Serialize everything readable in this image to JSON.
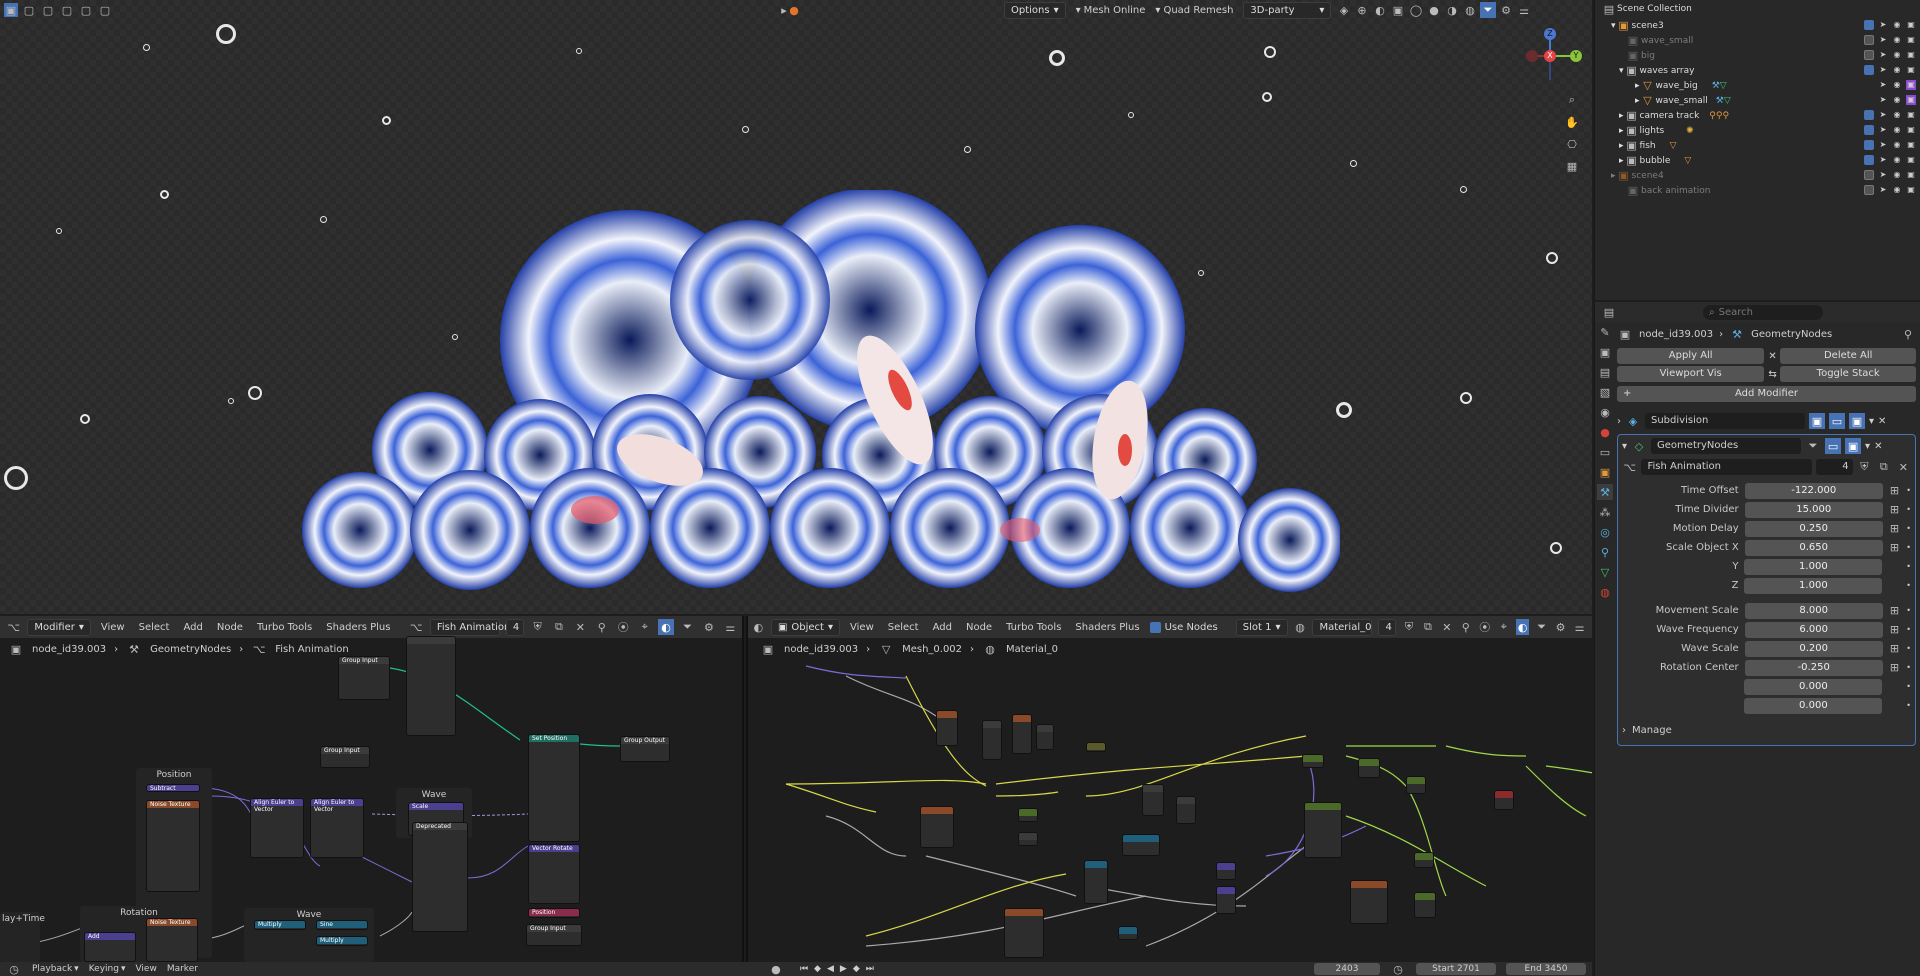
{
  "viewport": {
    "header": {
      "options": "Options",
      "addons": [
        "Mesh Online",
        "Quad Remesh"
      ],
      "category": "3D-party"
    },
    "gizmo": {
      "x": "X",
      "y": "Y",
      "z": "Z"
    }
  },
  "outliner": {
    "root": "Scene Collection",
    "items": [
      {
        "label": "scene3",
        "depth": 1
      },
      {
        "label": "wave_small",
        "depth": 2,
        "dim": true
      },
      {
        "label": "big",
        "depth": 2,
        "dim": true
      },
      {
        "label": "waves array",
        "depth": 2
      },
      {
        "label": "wave_big",
        "depth": 3
      },
      {
        "label": "wave_small",
        "depth": 3
      },
      {
        "label": "camera track",
        "depth": 2
      },
      {
        "label": "lights",
        "depth": 2
      },
      {
        "label": "fish",
        "depth": 2
      },
      {
        "label": "bubble",
        "depth": 2
      },
      {
        "label": "scene4",
        "depth": 1,
        "dim": true
      },
      {
        "label": "back animation",
        "depth": 2,
        "dim": true
      }
    ]
  },
  "properties": {
    "search_placeholder": "Search",
    "breadcrumb": {
      "object": "node_id39.003",
      "modifier": "GeometryNodes"
    },
    "buttons": {
      "apply_all": "Apply All",
      "delete_all": "Delete All",
      "viewport_vis": "Viewport Vis",
      "toggle_stack": "Toggle Stack",
      "add_modifier": "Add Modifier"
    },
    "modifiers": [
      {
        "name": "Subdivision"
      },
      {
        "name": "GeometryNodes"
      }
    ],
    "node_group": {
      "name": "Fish Animation",
      "users": "4"
    },
    "inputs": [
      {
        "label": "Time Offset",
        "value": "-122.000"
      },
      {
        "label": "Time Divider",
        "value": "15.000"
      },
      {
        "label": "Motion Delay",
        "value": "0.250"
      },
      {
        "label": "Scale Object X",
        "value": "0.650"
      },
      {
        "label": "Y",
        "value": "1.000"
      },
      {
        "label": "Z",
        "value": "1.000"
      },
      {
        "label": "Movement Scale",
        "value": "8.000"
      },
      {
        "label": "Wave Frequency",
        "value": "6.000"
      },
      {
        "label": "Wave Scale",
        "value": "0.200"
      },
      {
        "label": "Rotation Center",
        "value": "-0.250"
      },
      {
        "label": "",
        "value": "0.000"
      },
      {
        "label": "",
        "value": "0.000"
      }
    ],
    "manage": "Manage"
  },
  "geo_editor": {
    "editor_type": "Modifier",
    "menus": [
      "View",
      "Select",
      "Add",
      "Node",
      "Turbo Tools",
      "Shaders Plus"
    ],
    "node_group": "Fish Animation",
    "users": "4",
    "breadcrumb": [
      "node_id39.003",
      "GeometryNodes",
      "Fish Animation"
    ],
    "frames": {
      "position": "Position",
      "rotation": "Rotation",
      "wave_top": "Wave",
      "wave_bottom": "Wave",
      "time": "lay+Time"
    },
    "nodes": {
      "group_input": "Group Input",
      "group_output": "Group Output",
      "set_position": "Set Position",
      "deprecated": "Deprecated",
      "subtract": "Subtract",
      "noise": "Noise Texture",
      "align": "Align Euler to Vector",
      "vector_rotate": "Vector Rotate",
      "position": "Position",
      "multiply": "Multiply",
      "sine": "Sine",
      "scale": "Scale",
      "add": "Add"
    }
  },
  "shader_editor": {
    "editor_type": "Object",
    "menus": [
      "View",
      "Select",
      "Add",
      "Node",
      "Turbo Tools",
      "Shaders Plus"
    ],
    "use_nodes": "Use Nodes",
    "slot": "Slot 1",
    "material": "Material_0",
    "users": "4",
    "breadcrumb": [
      "node_id39.003",
      "Mesh_0.002",
      "Material_0"
    ]
  },
  "timeline": {
    "menus": [
      "Playback",
      "Keying",
      "View",
      "Marker"
    ],
    "current_frame": "2403",
    "start_label": "Start",
    "start": "2701",
    "end_label": "End",
    "end": "3450"
  },
  "colors": {
    "accent": "#4772b3",
    "header": "#303030",
    "panel": "#282828",
    "node_purple": "#4b3f8f",
    "node_teal": "#1f6f63"
  }
}
